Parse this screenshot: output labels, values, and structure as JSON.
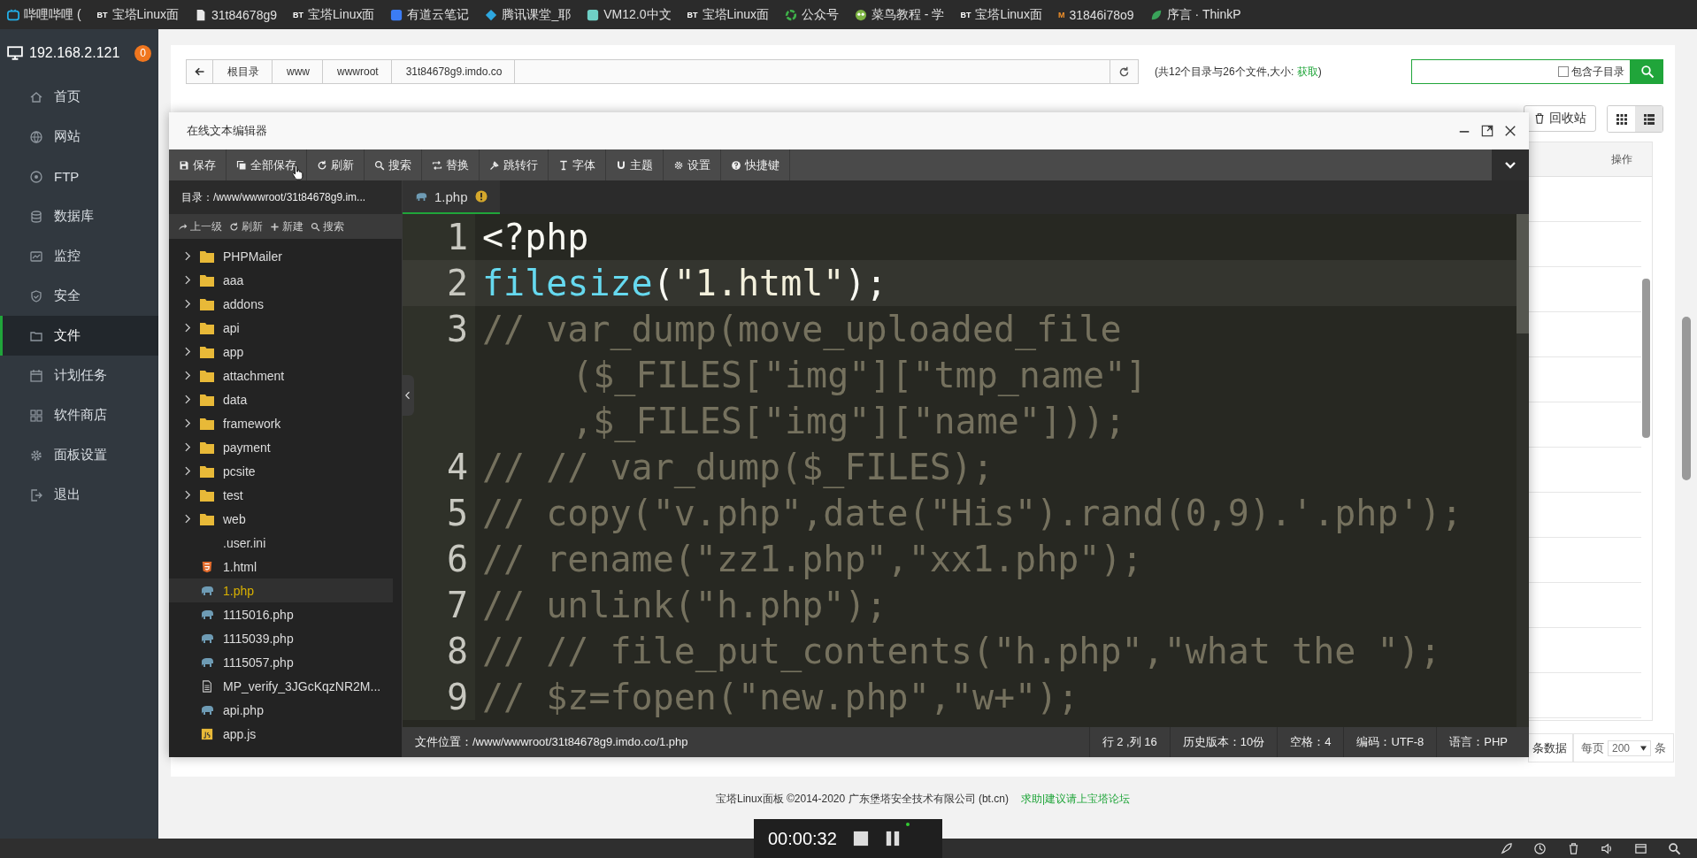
{
  "bookmarks": [
    {
      "label": "哔哩哔哩 (",
      "kind": "tv",
      "color": "#23ade5"
    },
    {
      "label": "宝塔Linux面",
      "kind": "badge",
      "badge": "BT",
      "color": "#ffffff"
    },
    {
      "label": "31t84678g9",
      "kind": "page",
      "color": "#e8e8e8"
    },
    {
      "label": "宝塔Linux面",
      "kind": "badge",
      "badge": "BT",
      "color": "#ffffff"
    },
    {
      "label": "有道云笔记",
      "kind": "square",
      "color": "#3b7cf5"
    },
    {
      "label": "腾讯课堂_耶",
      "kind": "diamond",
      "color": "#2ea7e0"
    },
    {
      "label": "VM12.0中文",
      "kind": "square",
      "color": "#6fd0c6"
    },
    {
      "label": "宝塔Linux面",
      "kind": "badge",
      "badge": "BT",
      "color": "#ffffff"
    },
    {
      "label": "公众号",
      "kind": "ring",
      "color": "#3fb24a"
    },
    {
      "label": "菜鸟教程 - 学",
      "kind": "face",
      "color": "#7cb342"
    },
    {
      "label": "宝塔Linux面",
      "kind": "badge",
      "badge": "BT",
      "color": "#ffffff"
    },
    {
      "label": "31846i78o9",
      "kind": "badge",
      "badge": "M",
      "color": "#f0902a"
    },
    {
      "label": "序言 · ThinkP",
      "kind": "leaf",
      "color": "#3aa35a"
    }
  ],
  "server": {
    "address": "192.168.2.121",
    "badge": "0"
  },
  "sidebar": {
    "items": [
      {
        "label": "首页",
        "selected": false
      },
      {
        "label": "网站",
        "selected": false
      },
      {
        "label": "FTP",
        "selected": false
      },
      {
        "label": "数据库",
        "selected": false
      },
      {
        "label": "监控",
        "selected": false
      },
      {
        "label": "安全",
        "selected": false
      },
      {
        "label": "文件",
        "selected": true
      },
      {
        "label": "计划任务",
        "selected": false
      },
      {
        "label": "软件商店",
        "selected": false
      },
      {
        "label": "面板设置",
        "selected": false
      },
      {
        "label": "退出",
        "selected": false
      }
    ]
  },
  "breadcrumb": [
    "根目录",
    "www",
    "wwwroot",
    "31t84678g9.imdo.co"
  ],
  "dir_info": {
    "text": "(共12个目录与26个文件,大小: ",
    "link": "获取",
    "end": ")"
  },
  "search": {
    "checkbox_label": "包含子目录",
    "checked": false
  },
  "recycle_button": "回收站",
  "view_toggle": [
    {
      "kind": "grid",
      "selected": false
    },
    {
      "kind": "list",
      "selected": true
    }
  ],
  "table": {
    "columns": [
      "操作"
    ]
  },
  "pager": {
    "total_suffix": "条数据",
    "per_page_label": "每页",
    "per_page": "200",
    "unit": "条"
  },
  "editor": {
    "title": "在线文本编辑器",
    "toolbar": [
      "保存",
      "全部保存",
      "刷新",
      "搜索",
      "替换",
      "跳转行",
      "字体",
      "主题",
      "设置",
      "快捷键"
    ],
    "directory": "目录：/www/wwwroot/31t84678g9.im...",
    "tree_toolbar": [
      "上一级",
      "刷新",
      "新建",
      "搜索"
    ],
    "files": [
      {
        "name": "PHPMailer",
        "kind": "folder",
        "selected": false
      },
      {
        "name": "aaa",
        "kind": "folder",
        "selected": false
      },
      {
        "name": "addons",
        "kind": "folder",
        "selected": false
      },
      {
        "name": "api",
        "kind": "folder",
        "selected": false
      },
      {
        "name": "app",
        "kind": "folder",
        "selected": false
      },
      {
        "name": "attachment",
        "kind": "folder",
        "selected": false
      },
      {
        "name": "data",
        "kind": "folder",
        "selected": false
      },
      {
        "name": "framework",
        "kind": "folder",
        "selected": false
      },
      {
        "name": "payment",
        "kind": "folder",
        "selected": false
      },
      {
        "name": "pcsite",
        "kind": "folder",
        "selected": false
      },
      {
        "name": "test",
        "kind": "folder",
        "selected": false
      },
      {
        "name": "web",
        "kind": "folder",
        "selected": false
      },
      {
        "name": ".user.ini",
        "kind": "plain",
        "selected": false
      },
      {
        "name": "1.html",
        "kind": "html",
        "selected": false
      },
      {
        "name": "1.php",
        "kind": "php",
        "selected": true
      },
      {
        "name": "1115016.php",
        "kind": "php",
        "selected": false
      },
      {
        "name": "1115039.php",
        "kind": "php",
        "selected": false
      },
      {
        "name": "1115057.php",
        "kind": "php",
        "selected": false
      },
      {
        "name": "MP_verify_3JGcKqzNR2M...",
        "kind": "text",
        "selected": false
      },
      {
        "name": "api.php",
        "kind": "php",
        "selected": false
      },
      {
        "name": "app.js",
        "kind": "js",
        "selected": false
      }
    ],
    "tabs": [
      {
        "label": "1.php",
        "selected": true,
        "modified": true
      }
    ],
    "lines": [
      {
        "number": "1",
        "active": false,
        "rows": [
          [
            {
              "kind": "plain",
              "text": "<?php"
            }
          ]
        ]
      },
      {
        "number": "2",
        "active": true,
        "rows": [
          [
            {
              "kind": "function",
              "text": "filesize"
            },
            {
              "kind": "plain",
              "text": "("
            },
            {
              "kind": "string",
              "text": "\"1.html\""
            },
            {
              "kind": "plain",
              "text": ");"
            }
          ]
        ]
      },
      {
        "number": "3",
        "active": false,
        "rows": [
          [
            {
              "kind": "comment",
              "text": "// var_dump(move_uploaded_file"
            }
          ],
          [
            {
              "kind": "comment",
              "text": "($_FILES[\"img\"][\"tmp_name\"]"
            }
          ],
          [
            {
              "kind": "comment",
              "text": ",$_FILES[\"img\"][\"name\"]));"
            }
          ]
        ]
      },
      {
        "number": "4",
        "active": false,
        "rows": [
          [
            {
              "kind": "comment",
              "text": "// // var_dump($_FILES);"
            }
          ]
        ]
      },
      {
        "number": "5",
        "active": false,
        "rows": [
          [
            {
              "kind": "comment",
              "text": "// copy(\"v.php\",date(\"His\").rand(0,9).'.php');"
            }
          ]
        ]
      },
      {
        "number": "6",
        "active": false,
        "rows": [
          [
            {
              "kind": "comment",
              "text": "// rename(\"zz1.php\",\"xx1.php\");"
            }
          ]
        ]
      },
      {
        "number": "7",
        "active": false,
        "rows": [
          [
            {
              "kind": "comment",
              "text": "// unlink(\"h.php\");"
            }
          ]
        ]
      },
      {
        "number": "8",
        "active": false,
        "rows": [
          [
            {
              "kind": "comment",
              "text": "// // file_put_contents(\"h.php\",\"what the \");"
            }
          ]
        ]
      },
      {
        "number": "9",
        "active": false,
        "rows": [
          [
            {
              "kind": "comment",
              "text": "// $z=fopen(\"new.php\",\"w+\");"
            }
          ]
        ]
      }
    ],
    "status": {
      "path": "文件位置：/www/wwwroot/31t84678g9.imdo.co/1.php",
      "items": [
        "行 2 ,列 16",
        "历史版本：10份",
        "空格：4",
        "编码：UTF-8",
        "语言：PHP"
      ]
    }
  },
  "footer": {
    "copyright": "宝塔Linux面板 ©2014-2020 广东堡塔安全技术有限公司 (bt.cn)",
    "link": "求助|建议请上宝塔论坛"
  },
  "recorder": {
    "time": "00:00:32"
  }
}
